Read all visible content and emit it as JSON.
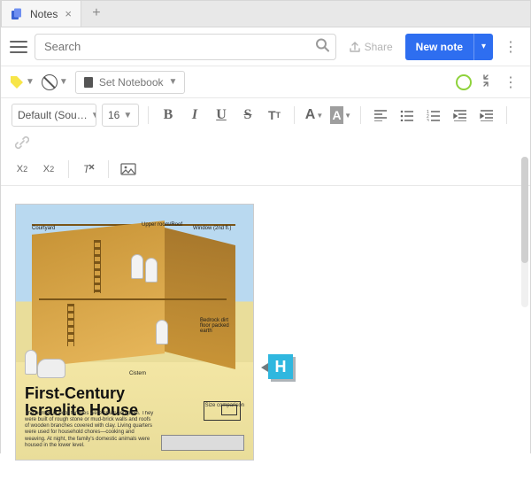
{
  "tab": {
    "title": "Notes"
  },
  "search": {
    "placeholder": "Search"
  },
  "share": {
    "label": "Share"
  },
  "newnote": {
    "label": "New note"
  },
  "notebook": {
    "placeholder": "Set Notebook"
  },
  "font": {
    "family": "Default (Sou…",
    "size": "16"
  },
  "image": {
    "title_line1": "First-Century",
    "title_line2": "Israelite House",
    "subtitle": "The homes of poor families were small and plain. They were built of rough stone or mud-brick walls and roofs of wooden branches covered with clay. Living quarters were used for household chores—cooking and weaving. At night, the family's domestic animals were housed in the lower level.",
    "size_label": "Size comparison",
    "labels": {
      "courtyard": "Courtyard",
      "upper_roof": "Upper room/Roof",
      "window": "Window (2nd fl.)",
      "bedrock": "Bedrock dirt floor packed earth",
      "cistern": "Cistern"
    }
  },
  "annotation": {
    "letter": "H"
  }
}
